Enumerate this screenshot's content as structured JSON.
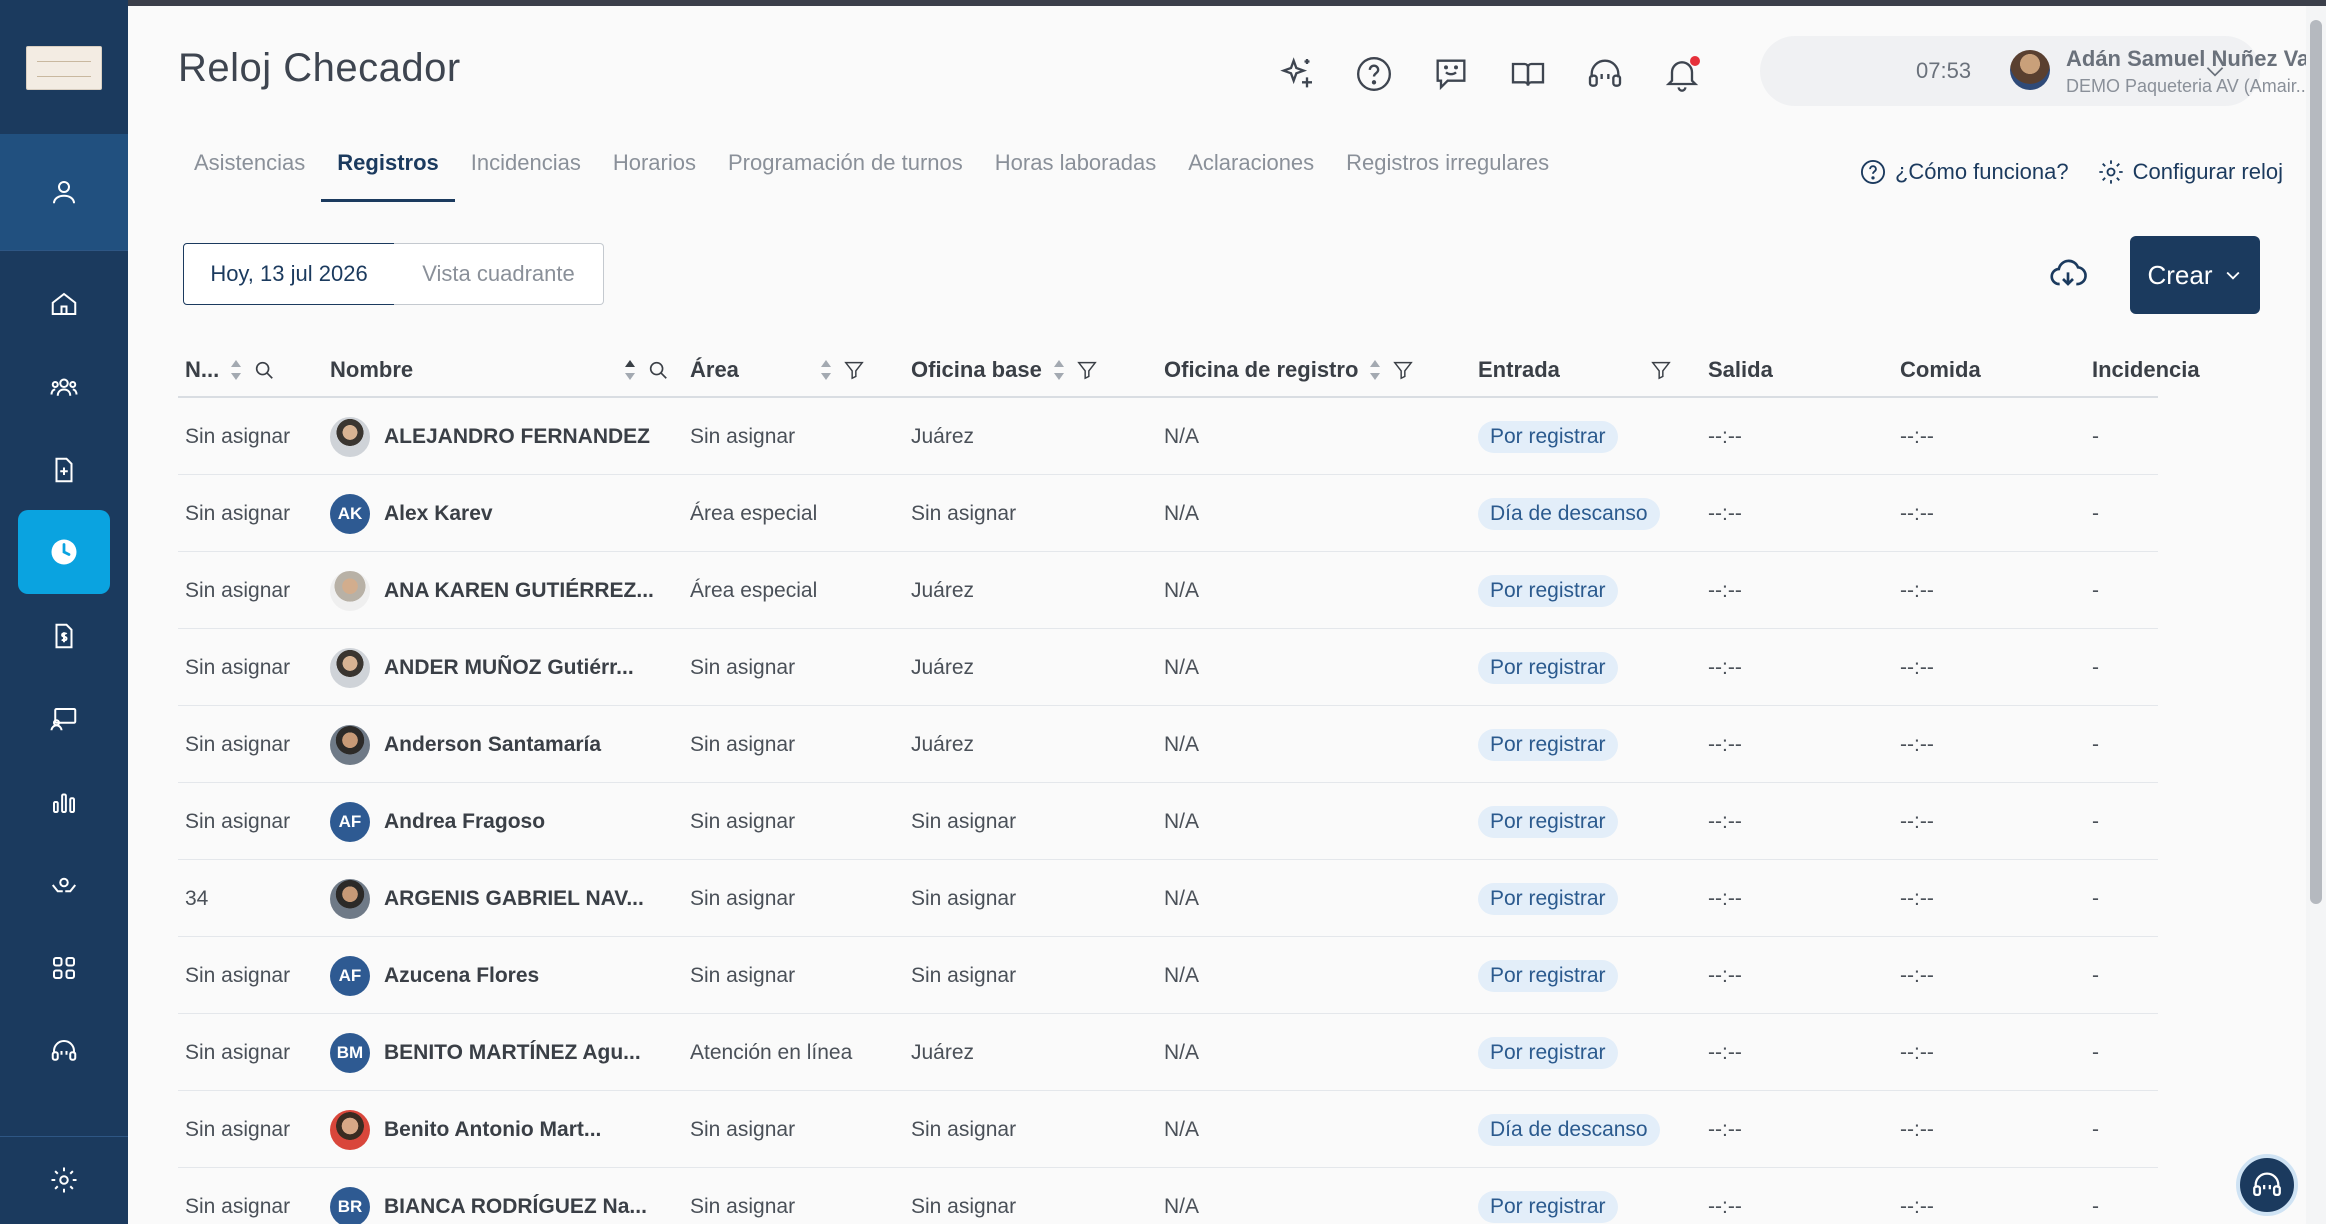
{
  "app": {
    "title": "Reloj Checador"
  },
  "header": {
    "time": "07:53",
    "user_name": "Adán Samuel Nuñez Val...",
    "company": "DEMO Paqueteria AV (Amair..."
  },
  "tabs": [
    {
      "label": "Asistencias"
    },
    {
      "label": "Registros",
      "active": true
    },
    {
      "label": "Incidencias"
    },
    {
      "label": "Horarios"
    },
    {
      "label": "Programación de turnos"
    },
    {
      "label": "Horas laboradas"
    },
    {
      "label": "Aclaraciones"
    },
    {
      "label": "Registros irregulares"
    }
  ],
  "help": {
    "how_it_works": "¿Cómo funciona?",
    "configure": "Configurar reloj"
  },
  "toolbar": {
    "date_label": "Hoy, 13 jul 2026",
    "view_label": "Vista cuadrante",
    "create_label": "Crear"
  },
  "columns": {
    "num": "N...",
    "name": "Nombre",
    "area": "Área",
    "base_office": "Oficina base",
    "reg_office": "Oficina de registro",
    "entry": "Entrada",
    "exit": "Salida",
    "meal": "Comida",
    "incident": "Incidencia"
  },
  "rows": [
    {
      "num": "Sin asignar",
      "name": "ALEJANDRO FERNANDEZ",
      "avatar": "photo",
      "area": "Sin asignar",
      "base": "Juárez",
      "reg": "N/A",
      "entry": "Por registrar",
      "exit": "--:--",
      "meal": "--:--",
      "incident": "-"
    },
    {
      "num": "Sin asignar",
      "name": "Alex Karev",
      "initials": "AK",
      "area": "Área especial",
      "base": "Sin asignar",
      "reg": "N/A",
      "entry": "Día de descanso",
      "exit": "--:--",
      "meal": "--:--",
      "incident": "-"
    },
    {
      "num": "Sin asignar",
      "name": "ANA KAREN GUTIÉRREZ...",
      "avatar": "photo3",
      "area": "Área especial",
      "base": "Juárez",
      "reg": "N/A",
      "entry": "Por registrar",
      "exit": "--:--",
      "meal": "--:--",
      "incident": "-"
    },
    {
      "num": "Sin asignar",
      "name": "ANDER MUÑOZ Gutiérr...",
      "avatar": "photo",
      "area": "Sin asignar",
      "base": "Juárez",
      "reg": "N/A",
      "entry": "Por registrar",
      "exit": "--:--",
      "meal": "--:--",
      "incident": "-"
    },
    {
      "num": "Sin asignar",
      "name": "Anderson Santamaría",
      "avatar": "photo2",
      "area": "Sin asignar",
      "base": "Juárez",
      "reg": "N/A",
      "entry": "Por registrar",
      "exit": "--:--",
      "meal": "--:--",
      "incident": "-"
    },
    {
      "num": "Sin asignar",
      "name": "Andrea Fragoso",
      "initials": "AF",
      "area": "Sin asignar",
      "base": "Sin asignar",
      "reg": "N/A",
      "entry": "Por registrar",
      "exit": "--:--",
      "meal": "--:--",
      "incident": "-"
    },
    {
      "num": "34",
      "name": "ARGENIS GABRIEL NAV...",
      "avatar": "photo2",
      "area": "Sin asignar",
      "base": "Sin asignar",
      "reg": "N/A",
      "entry": "Por registrar",
      "exit": "--:--",
      "meal": "--:--",
      "incident": "-"
    },
    {
      "num": "Sin asignar",
      "name": "Azucena Flores",
      "initials": "AF",
      "area": "Sin asignar",
      "base": "Sin asignar",
      "reg": "N/A",
      "entry": "Por registrar",
      "exit": "--:--",
      "meal": "--:--",
      "incident": "-"
    },
    {
      "num": "Sin asignar",
      "name": "BENITO MARTÍNEZ Agu...",
      "initials": "BM",
      "area": "Atención en línea",
      "base": "Juárez",
      "reg": "N/A",
      "entry": "Por registrar",
      "exit": "--:--",
      "meal": "--:--",
      "incident": "-"
    },
    {
      "num": "Sin asignar",
      "name": "Benito Antonio Mart...",
      "avatar": "photo4",
      "area": "Sin asignar",
      "base": "Sin asignar",
      "reg": "N/A",
      "entry": "Día de descanso",
      "exit": "--:--",
      "meal": "--:--",
      "incident": "-"
    },
    {
      "num": "Sin asignar",
      "name": "BIANCA RODRÍGUEZ Na...",
      "initials": "BR",
      "area": "Sin asignar",
      "base": "Sin asignar",
      "reg": "N/A",
      "entry": "Por registrar",
      "exit": "--:--",
      "meal": "--:--",
      "incident": "-"
    }
  ],
  "colors": {
    "primary": "#1b3a5e",
    "accent": "#0aa3e0",
    "badge_bg": "#e3eef9",
    "badge_text": "#2b5a8e"
  }
}
